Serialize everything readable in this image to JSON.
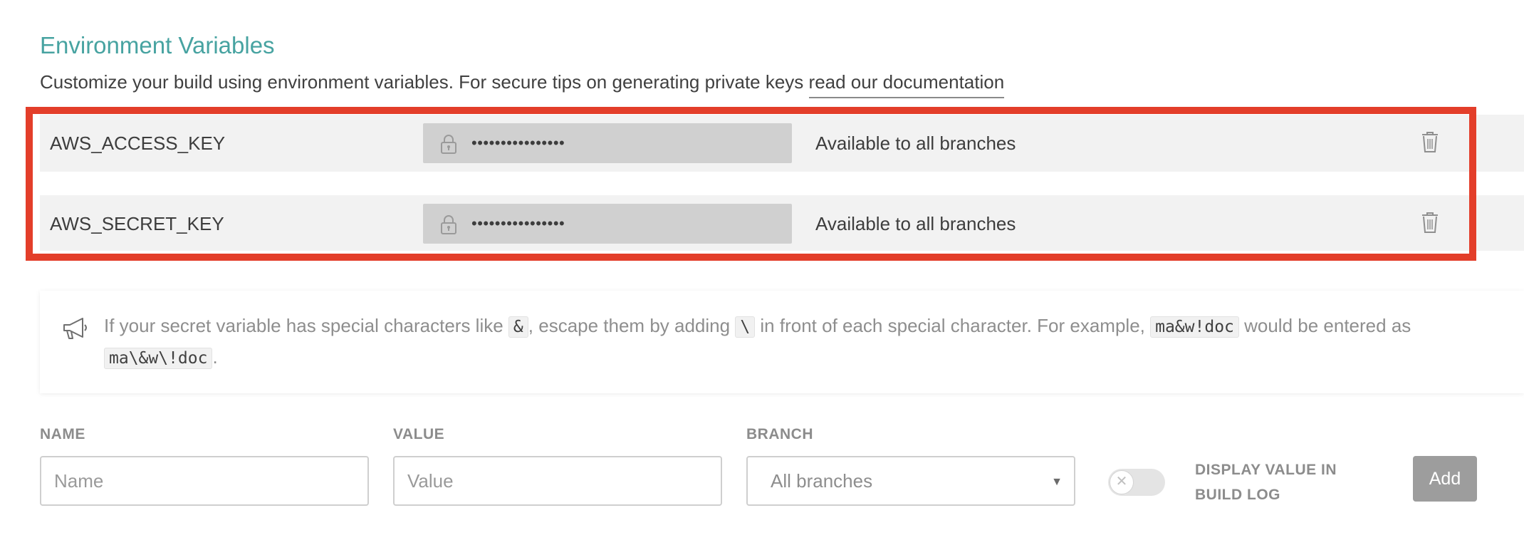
{
  "section": {
    "title": "Environment Variables",
    "description": "Customize your build using environment variables. For secure tips on generating private keys ",
    "doc_link": "read our documentation"
  },
  "env_vars": [
    {
      "name": "AWS_ACCESS_KEY",
      "value_masked": "••••••••••••••••",
      "branch": "Available to all branches"
    },
    {
      "name": "AWS_SECRET_KEY",
      "value_masked": "••••••••••••••••",
      "branch": "Available to all branches"
    }
  ],
  "notice": {
    "part1": "If your secret variable has special characters like ",
    "code1": "&",
    "part2": ", escape them by adding ",
    "code2": "\\",
    "part3": " in front of each special character. For example, ",
    "code3": "ma&w!doc",
    "part4": " would be entered as ",
    "code4": "ma\\&w\\!doc",
    "part5": "."
  },
  "form": {
    "name_label": "NAME",
    "name_placeholder": "Name",
    "value_label": "VALUE",
    "value_placeholder": "Value",
    "branch_label": "BRANCH",
    "branch_selected": "All branches",
    "display_label": "DISPLAY VALUE IN BUILD LOG",
    "add_label": "Add"
  },
  "colors": {
    "title": "#47a3a1",
    "highlight_border": "#e33e2a",
    "row_bg": "#f2f2f2",
    "masked_bg": "#d0d0d0",
    "add_button": "#9d9d9d"
  },
  "icons": [
    "lock-icon",
    "trash-icon",
    "megaphone-icon",
    "caret-down-icon",
    "close-icon"
  ]
}
